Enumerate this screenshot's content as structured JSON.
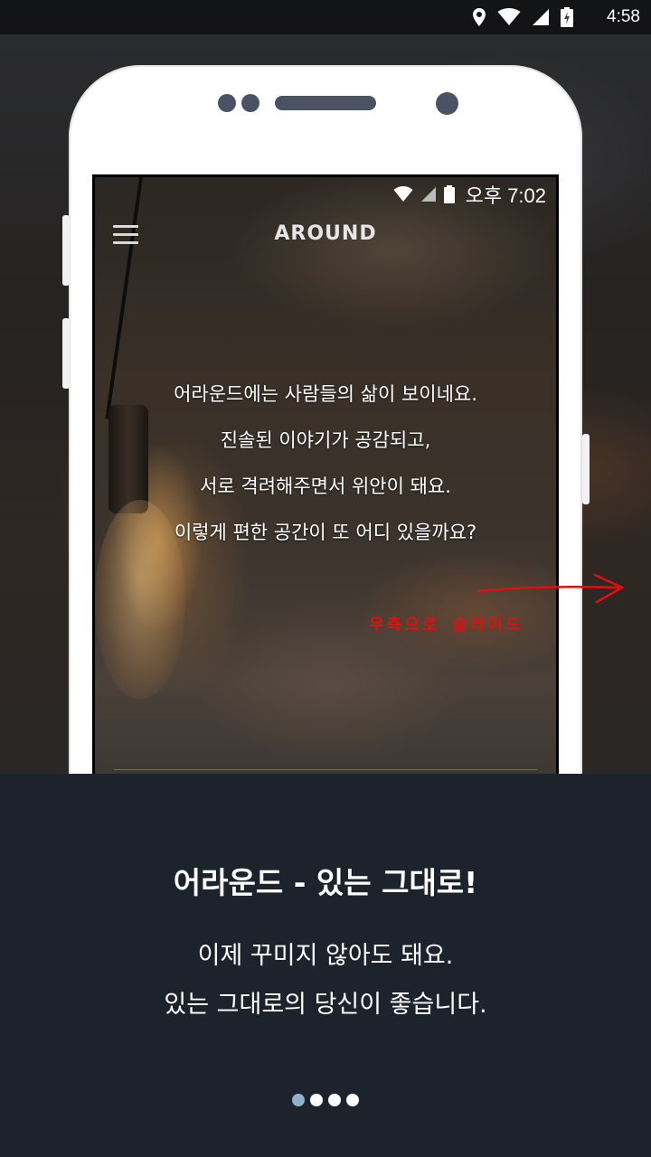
{
  "status_bar": {
    "time": "4:58",
    "icons": [
      "location-icon",
      "wifi-icon",
      "signal-icon",
      "battery-charging-icon"
    ]
  },
  "mockup": {
    "status_time": "오후 7:02",
    "app_name": "AROUND",
    "intro_lines": [
      "어라운드에는 사람들의 삶이 보이네요.",
      "진솔된 이야기가 공감되고,",
      "서로 격려해주면서 위안이 돼요.",
      "이렇게 편한 공간이 또 어디 있을까요?"
    ],
    "slide_hint": "우측으로 슬라이드"
  },
  "panel": {
    "title": "어라운드 - 있는 그대로!",
    "description_lines": [
      "이제 꾸미지 않아도 돼요.",
      "있는 그대로의 당신이 좋습니다."
    ]
  },
  "pager": {
    "count": 4,
    "active_index": 0
  },
  "colors": {
    "panel_bg": "#1c232d",
    "active_dot": "#8fb3cc",
    "hint_red": "#e01010"
  }
}
